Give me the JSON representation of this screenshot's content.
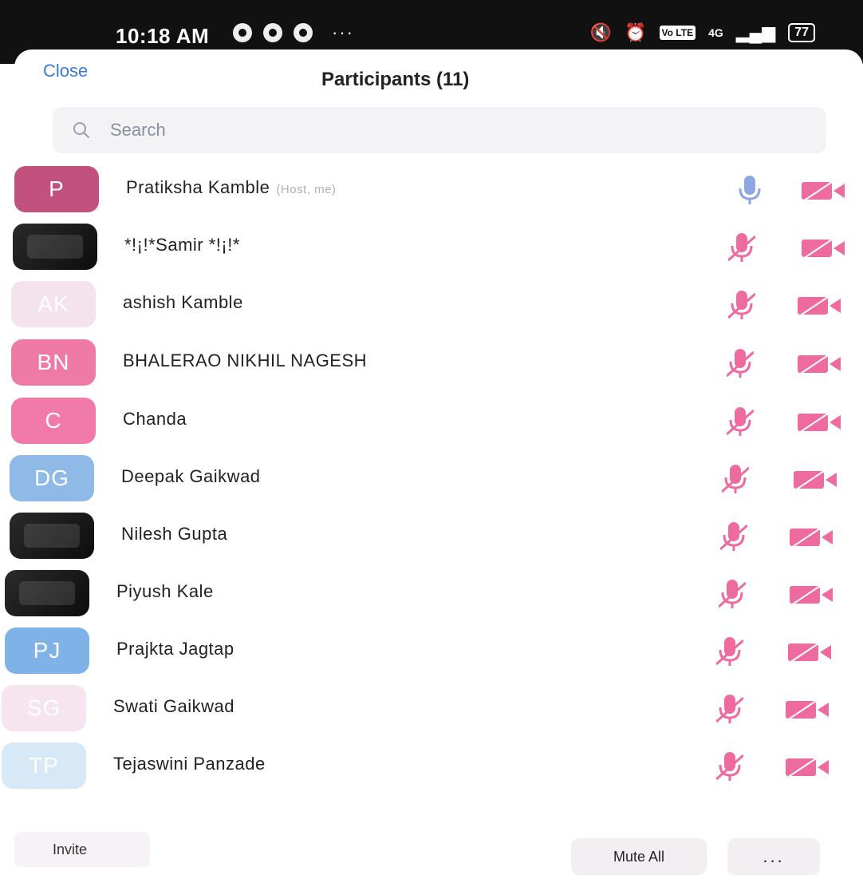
{
  "status_bar": {
    "time": "10:18 AM",
    "more": "···",
    "network": "4G",
    "lte": "Vo LTE",
    "battery": "77"
  },
  "header": {
    "close_label": "Close",
    "title": "Participants (11)"
  },
  "search": {
    "placeholder": "Search"
  },
  "participants": [
    {
      "initials": "P",
      "name": "Pratiksha Kamble",
      "role": "(Host, me)",
      "avatar_color": "#c2517e",
      "photo": false,
      "mic": "on",
      "video": "off"
    },
    {
      "initials": "",
      "name": "*!¡!*Samir *!¡!*",
      "role": "",
      "avatar_color": "#1a1a1a",
      "photo": true,
      "mic": "off",
      "video": "off"
    },
    {
      "initials": "AK",
      "name": "ashish Kamble",
      "role": "",
      "avatar_color": "#f4e3ec",
      "photo": false,
      "mic": "off",
      "video": "off"
    },
    {
      "initials": "BN",
      "name": "BHALERAO NIKHIL NAGESH",
      "role": "",
      "avatar_color": "#f07aa6",
      "photo": false,
      "mic": "off",
      "video": "off"
    },
    {
      "initials": "C",
      "name": "Chanda",
      "role": "",
      "avatar_color": "#f27aa8",
      "photo": false,
      "mic": "off",
      "video": "off"
    },
    {
      "initials": "DG",
      "name": "Deepak Gaikwad",
      "role": "",
      "avatar_color": "#8fb9e6",
      "photo": false,
      "mic": "off",
      "video": "off"
    },
    {
      "initials": "",
      "name": "Nilesh Gupta",
      "role": "",
      "avatar_color": "#3a3030",
      "photo": true,
      "mic": "off",
      "video": "off"
    },
    {
      "initials": "",
      "name": "Piyush Kale",
      "role": "",
      "avatar_color": "#111111",
      "photo": true,
      "mic": "off",
      "video": "off"
    },
    {
      "initials": "PJ",
      "name": "Prajkta Jagtap",
      "role": "",
      "avatar_color": "#7fb3e8",
      "photo": false,
      "mic": "off",
      "video": "off"
    },
    {
      "initials": "SG",
      "name": "Swati Gaikwad",
      "role": "",
      "avatar_color": "#f6e5ee",
      "photo": false,
      "mic": "off",
      "video": "off"
    },
    {
      "initials": "TP",
      "name": "Tejaswini Panzade",
      "role": "",
      "avatar_color": "#d7e8f7",
      "photo": false,
      "mic": "off",
      "video": "off"
    }
  ],
  "footer": {
    "invite_label": "Invite",
    "mute_all_label": "Mute All",
    "more_label": "..."
  },
  "colors": {
    "accent": "#3a7bd5",
    "muted_icon": "#ee6ba0",
    "mic_on": "#8fa6e6"
  }
}
